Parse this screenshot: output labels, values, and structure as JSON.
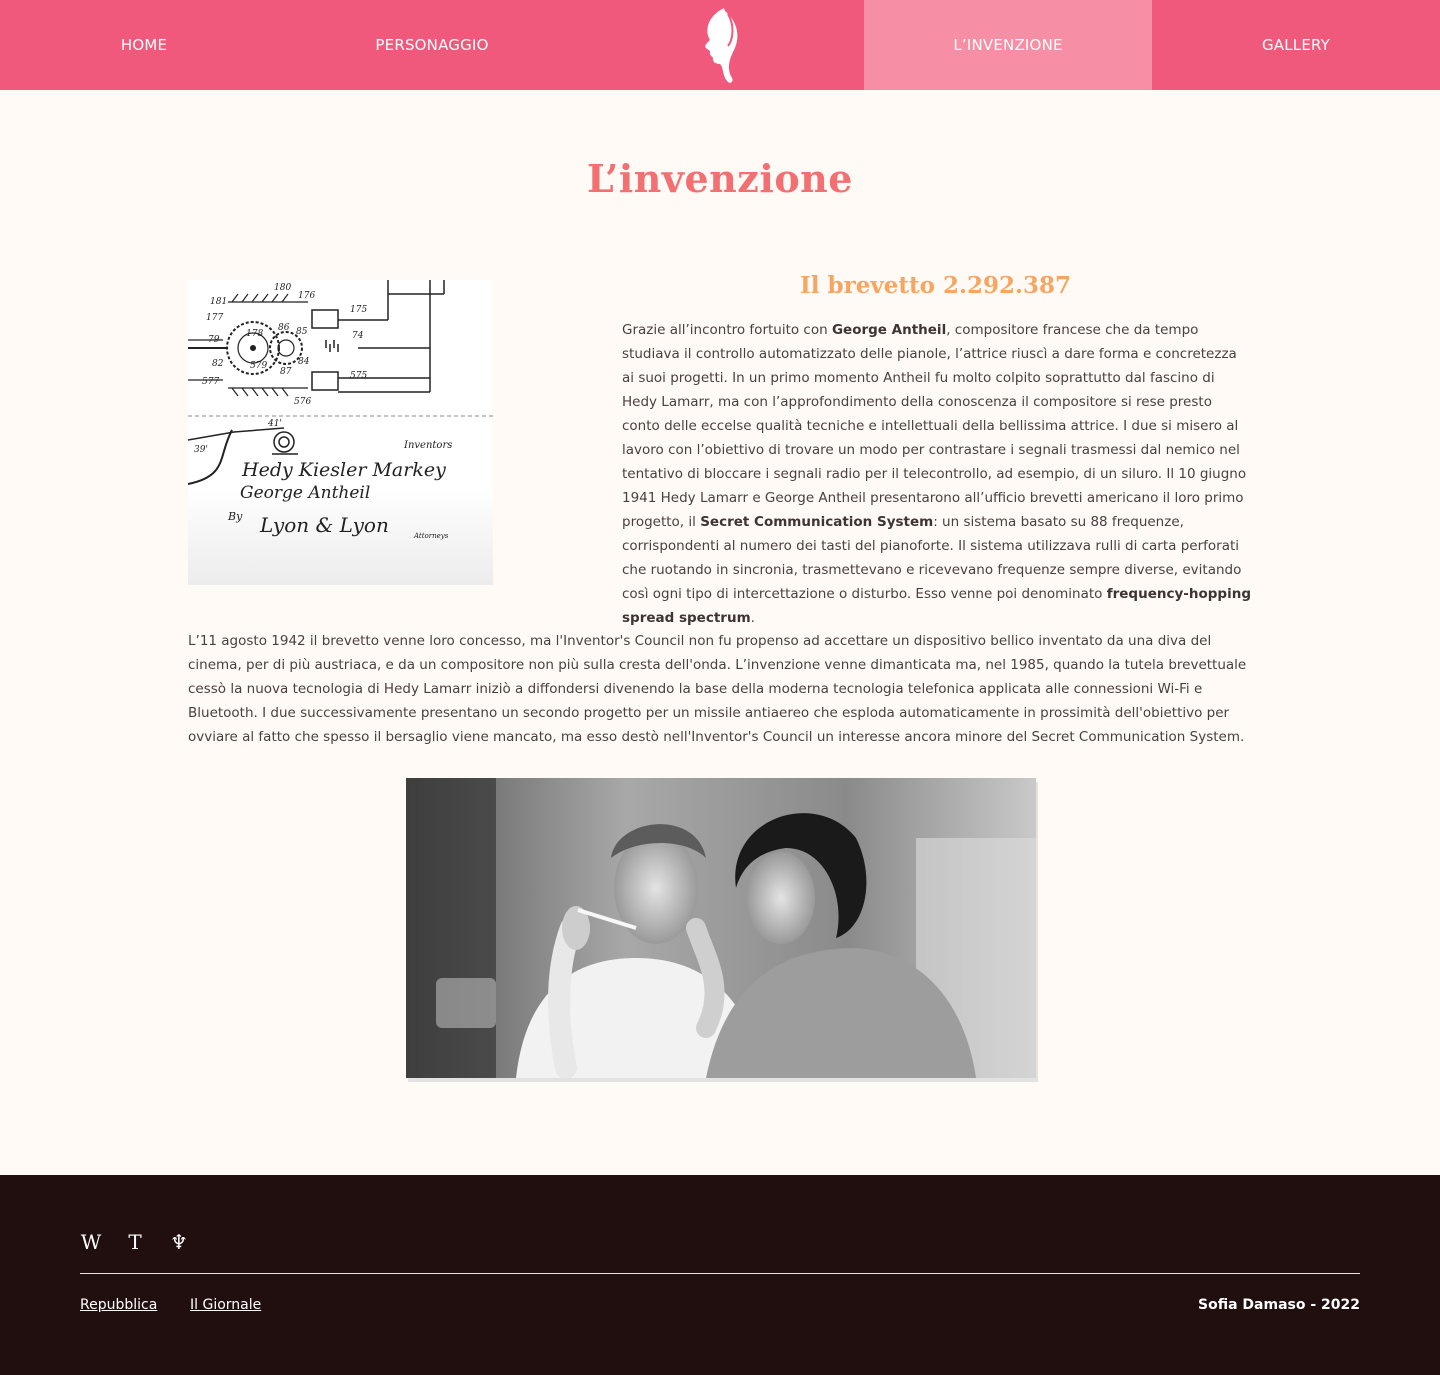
{
  "nav": {
    "items": [
      {
        "label": "HOME"
      },
      {
        "label": "PERSONAGGIO"
      },
      {
        "label": "L’INVENZIONE",
        "active": true
      },
      {
        "label": "GALLERY"
      }
    ],
    "logo_icon": "woman-profile-logo-icon"
  },
  "page_title": "L’invenzione",
  "section": {
    "heading": "Il brevetto 2.292.387",
    "para1": [
      {
        "t": "Grazie all’incontro fortuito con "
      },
      {
        "t": "George Antheil",
        "b": true
      },
      {
        "t": ", compositore francese che da tempo studiava il controllo automatizzato delle pianole, l’attrice riuscì a dare forma e concretezza ai suoi progetti. In un primo momento Antheil fu molto colpito soprattutto dal fascino di Hedy Lamarr, ma con l’approfondimento della conoscenza il compositore si rese presto conto delle eccelse qualità tecniche e intellettuali della bellissima attrice. I due si misero al lavoro con l’obiettivo di trovare un modo per contrastare i segnali trasmessi dal nemico nel tentativo di bloccare i segnali radio per il telecontrollo, ad esempio, di un siluro. Il 10 giugno 1941 Hedy Lamarr e George Antheil presentarono all’ufficio brevetti americano il loro primo progetto, il "
      },
      {
        "t": "Secret Communication System",
        "b": true
      },
      {
        "t": ": un sistema basato su 88 frequenze, corrispondenti al numero dei tasti del pianoforte. Il sistema utilizzava rulli di carta perforati che ruotando in sincronia, trasmettevano e ricevevano frequenze sempre diverse, evitando così ogni tipo di intercettazione o disturbo. Esso venne poi denominato "
      },
      {
        "t": "frequency-hopping spread spectrum",
        "b": true
      },
      {
        "t": "."
      }
    ],
    "para2": "L’11 agosto 1942 il brevetto venne loro concesso, ma l'Inventor's Council non fu propenso ad accettare un dispositivo bellico inventato da una diva del cinema, per di più austriaca, e da un compositore non più sulla cresta dell'onda. L’invenzione venne dimanticata ma, nel 1985, quando la tutela brevettuale cessò la nuova tecnologia di Hedy  Lamarr iniziò a diffondersi divenendo la base della moderna tecnologia telefonica applicata alle connessioni Wi-Fi e Bluetooth. I due successivamente presentano un secondo progetto per un missile antiaereo che esploda automaticamente in prossimità dell'obiettivo per ovviare al fatto che spesso il bersaglio viene mancato, ma esso destò nell'Inventor's Council un interesse ancora minore del Secret Communication System."
  },
  "patent_drawing": {
    "numbers": [
      "181",
      "180",
      "176",
      "177",
      "175",
      "79",
      "178",
      "86",
      "85",
      "74",
      "82",
      "579",
      "84",
      "577",
      "87",
      "575",
      "576",
      "41'",
      "39'"
    ],
    "inventors_label": "Inventors",
    "signature_1": "Hedy Kiesler Markey",
    "signature_2": "George Antheil",
    "by_label": "By",
    "attorney_signature": "Lyon & Lyon",
    "attorneys_label": "Attorneys"
  },
  "footer": {
    "social": [
      {
        "glyph": "W",
        "icon": "wikipedia-icon"
      },
      {
        "glyph": "T",
        "icon": "treccani-icon"
      },
      {
        "glyph": "♆",
        "icon": "crest-icon"
      }
    ],
    "links": [
      "Repubblica",
      "Il Giornale"
    ],
    "credit": "Sofia Damaso - 2022"
  },
  "colors": {
    "nav_bg": "#f0597b",
    "nav_active": "#f68fa5",
    "title": "#f26f72",
    "heading": "#f7a561",
    "page_bg": "#fffaf6",
    "footer_bg": "#210f10"
  }
}
